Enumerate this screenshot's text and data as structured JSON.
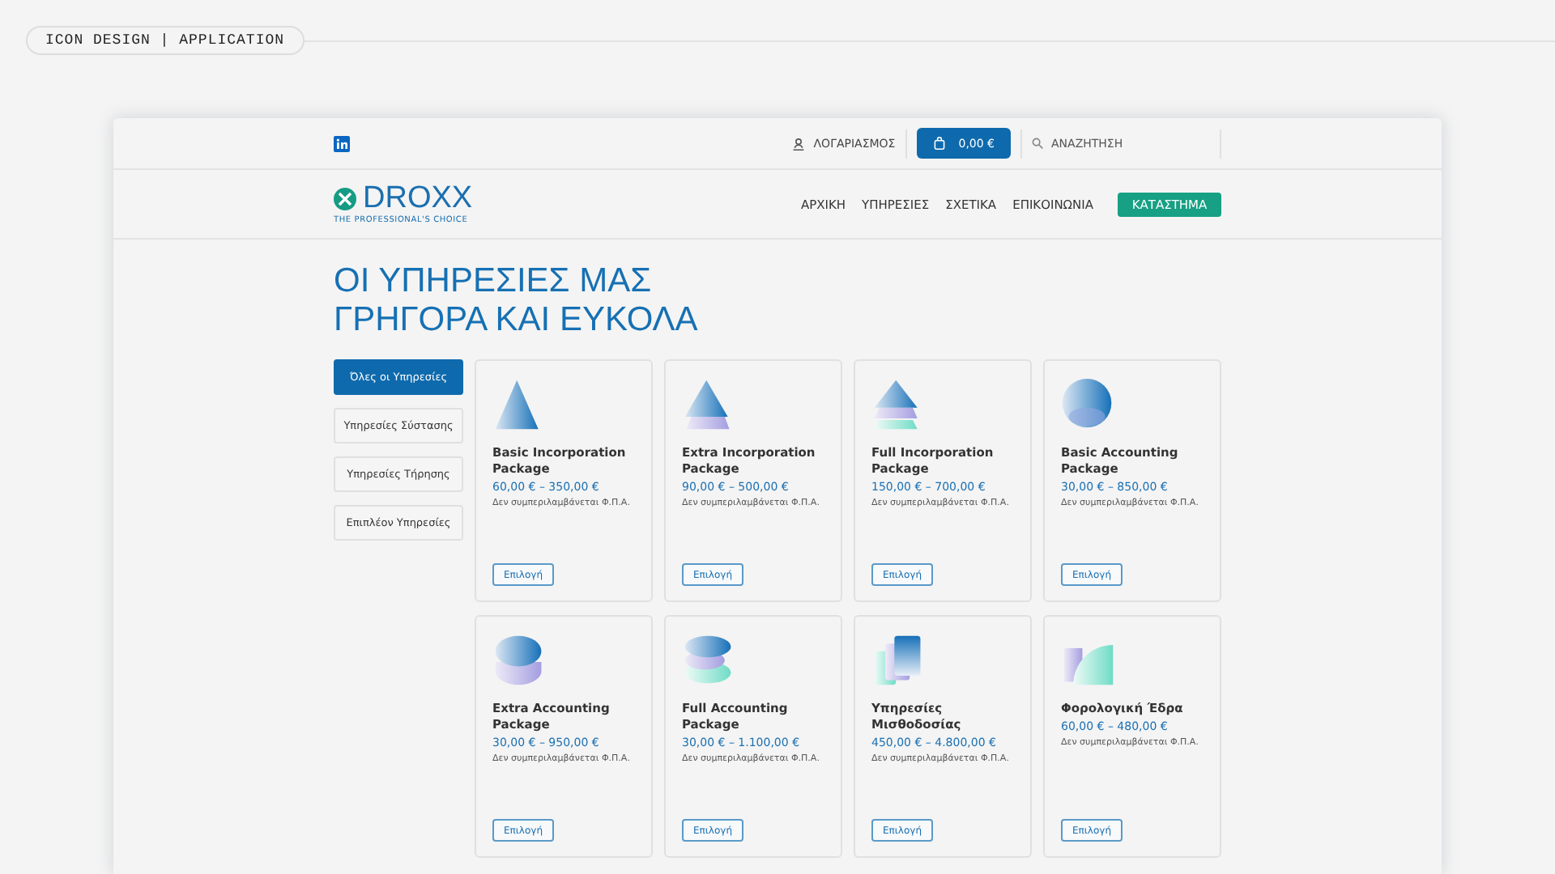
{
  "section_label": "ICON DESIGN | APPLICATION",
  "topbar": {
    "account": "ΛΟΓΑΡΙΑΣΜΟΣ",
    "cart_total": "0,00 €",
    "search_placeholder": "ΑΝΑΖΗΤΗΣΗ"
  },
  "logo": {
    "name": "DROXX",
    "tagline": "THE PROFESSIONAL'S CHOICE"
  },
  "nav": [
    {
      "label": "ΑΡΧΙΚΗ",
      "kind": "link"
    },
    {
      "label": "ΥΠΗΡΕΣΙΕΣ",
      "kind": "link"
    },
    {
      "label": "ΣΧΕΤΙΚΑ",
      "kind": "link"
    },
    {
      "label": "ΕΠΙΚΟΙΝΩΝΙΑ",
      "kind": "link"
    },
    {
      "label": "ΚΑΤΑΣΤΗΜΑ",
      "kind": "cta"
    }
  ],
  "heading": [
    "ΟΙ ΥΠΗΡΕΣΙΕΣ ΜΑΣ",
    "ΓΡΗΓΟΡΑ ΚΑΙ ΕΥΚΟΛΑ"
  ],
  "categories": [
    {
      "label": "Όλες οι Υπηρεσίες",
      "selected": true
    },
    {
      "label": "Υπηρεσίες Σύστασης",
      "selected": false
    },
    {
      "label": "Υπηρεσίες Τήρησης",
      "selected": false
    },
    {
      "label": "Επιπλέον Υπηρεσίες",
      "selected": false
    }
  ],
  "products": [
    {
      "kind": "pyramid",
      "name": "Basic Incorporation Package",
      "price": "60,00 € – 350,00 €",
      "note": "Δεν συμπεριλαμβάνεται Φ.Π.Α.",
      "button": "Επιλογή"
    },
    {
      "kind": "pyramid2",
      "name": "Extra Incorporation Package",
      "price": "90,00 € – 500,00 €",
      "note": "Δεν συμπεριλαμβάνεται Φ.Π.Α.",
      "button": "Επιλογή"
    },
    {
      "kind": "pyramid3",
      "name": "Full Incorporation Package",
      "price": "150,00 € – 700,00 €",
      "note": "Δεν συμπεριλαμβάνεται Φ.Π.Α.",
      "button": "Επιλογή"
    },
    {
      "kind": "sphere",
      "name": "Basic Accounting Package",
      "price": "30,00 € – 850,00 €",
      "note": "Δεν συμπεριλαμβάνεται Φ.Π.Α.",
      "button": "Επιλογή"
    },
    {
      "kind": "ring",
      "name": "Extra Accounting Package",
      "price": "30,00 € – 950,00 €",
      "note": "Δεν συμπεριλαμβάνεται Φ.Π.Α.",
      "button": "Επιλογή"
    },
    {
      "kind": "sring",
      "name": "Full Accounting Package",
      "price": "30,00 € – 1.100,00 €",
      "note": "Δεν συμπεριλαμβάνεται Φ.Π.Α.",
      "button": "Επιλογή"
    },
    {
      "kind": "cards",
      "name": "Υπηρεσίες Μισθοδοσίας",
      "price": "450,00 € – 4.800,00 €",
      "note": "Δεν συμπεριλαμβάνεται Φ.Π.Α.",
      "button": "Επιλογή"
    },
    {
      "kind": "quarter",
      "name": "Φορολογική Έδρα",
      "price": "60,00 € – 480,00 €",
      "note": "Δεν συμπεριλαμβάνεται Φ.Π.Α.",
      "button": "Επιλογή"
    }
  ]
}
